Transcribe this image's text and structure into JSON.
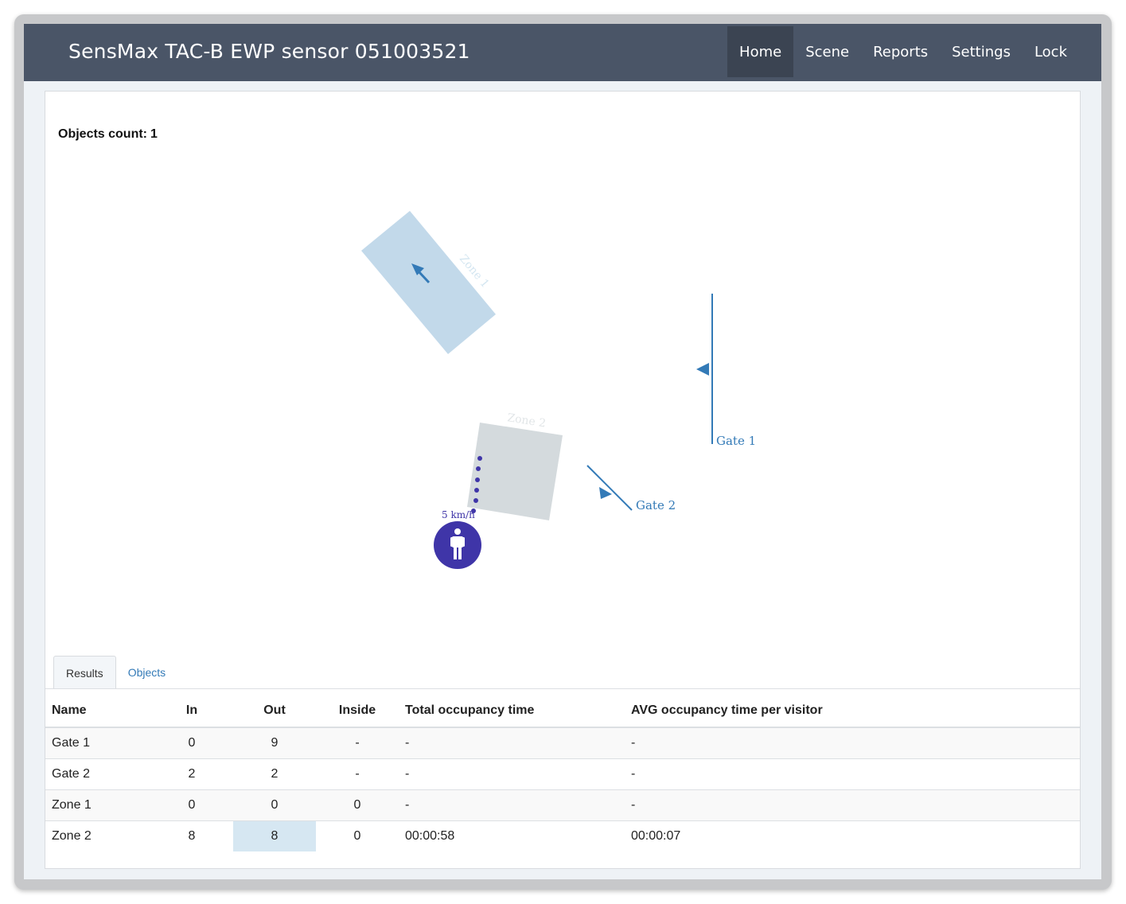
{
  "app": {
    "title": "SensMax TAC-B EWP sensor 051003521"
  },
  "nav": {
    "items": [
      {
        "label": "Home",
        "active": true
      },
      {
        "label": "Scene"
      },
      {
        "label": "Reports"
      },
      {
        "label": "Settings"
      },
      {
        "label": "Lock"
      }
    ]
  },
  "objects": {
    "label": "Objects count:",
    "value": "1"
  },
  "scene": {
    "zones": [
      {
        "name": "Zone 1",
        "color": "#c2d9ea"
      },
      {
        "name": "Zone 2",
        "color": "#d4dadd"
      }
    ],
    "gates": [
      {
        "name": "Gate 1",
        "color": "#337ab7"
      },
      {
        "name": "Gate 2",
        "color": "#337ab7"
      }
    ],
    "object": {
      "icon": "person-icon",
      "speed": "5 km/h",
      "color": "#3f35a8"
    }
  },
  "tabs": [
    {
      "label": "Results",
      "active": true
    },
    {
      "label": "Objects"
    }
  ],
  "table": {
    "headers": [
      "Name",
      "In",
      "Out",
      "Inside",
      "Total occupancy time",
      "AVG occupancy time per visitor"
    ],
    "rows": [
      [
        "Gate 1",
        "0",
        "9",
        "-",
        "-",
        "-"
      ],
      [
        "Gate 2",
        "2",
        "2",
        "-",
        "-",
        "-"
      ],
      [
        "Zone 1",
        "0",
        "0",
        "0",
        "-",
        "-"
      ],
      [
        "Zone 2",
        "8",
        "8",
        "0",
        "00:00:58",
        "00:00:07"
      ]
    ]
  }
}
